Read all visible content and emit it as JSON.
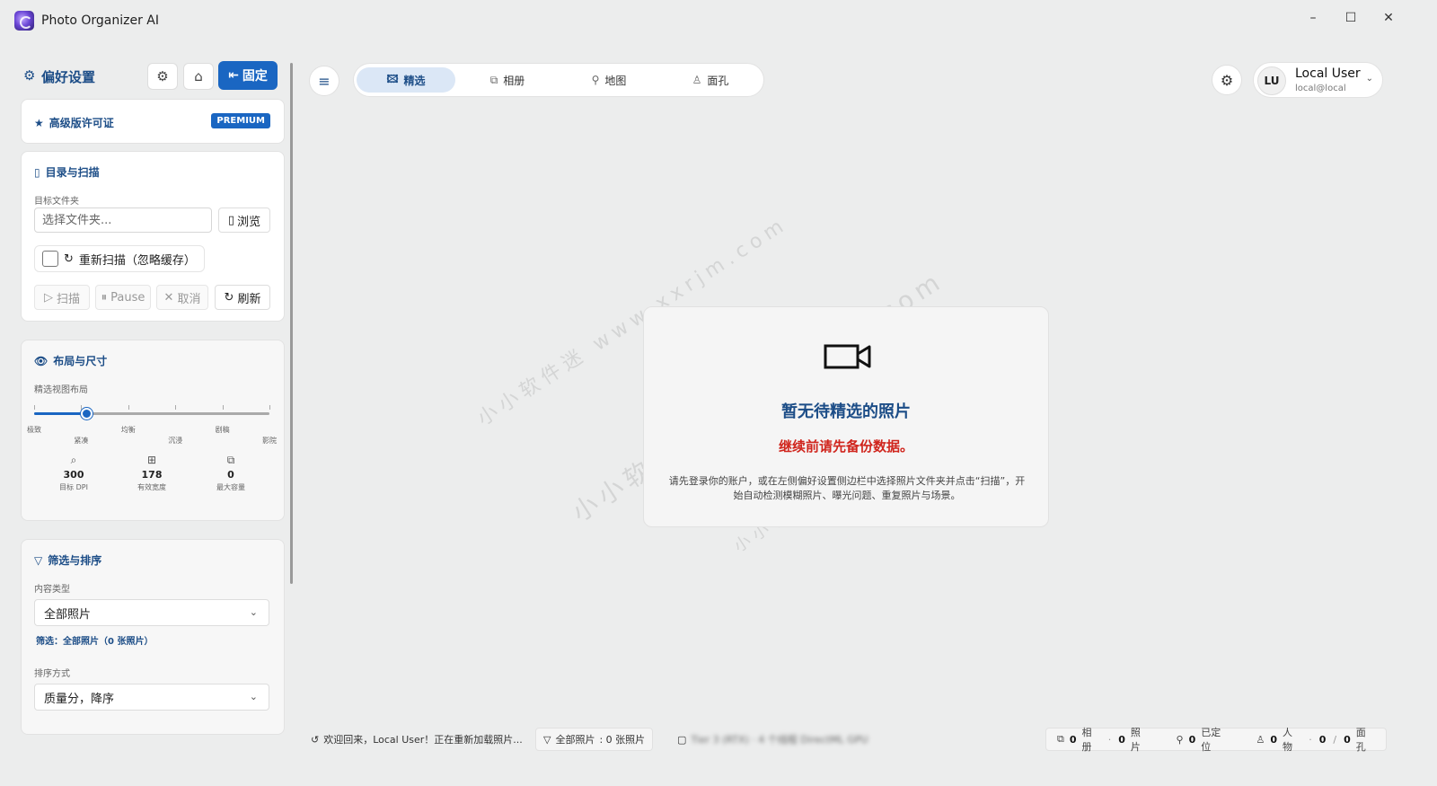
{
  "app": {
    "title": "Photo Organizer AI"
  },
  "window": {
    "minimize": "–",
    "maximize": "☐",
    "close": "✕"
  },
  "sidebar": {
    "header_title": "偏好设置",
    "pin_label": "固定",
    "premium": {
      "label": "高级版许可证",
      "badge": "PREMIUM"
    },
    "directory": {
      "title": "目录与扫描",
      "folder_label": "目标文件夹",
      "folder_placeholder": "选择文件夹...",
      "browse_label": "浏览",
      "rescan_label": "重新扫描（忽略缓存）",
      "scan_label": "扫描",
      "pause_label": "Pause",
      "cancel_label": "取消",
      "refresh_label": "刷新"
    },
    "layout": {
      "title": "布局与尺寸",
      "view_label": "精选视图布局",
      "slider_value_percent": 22,
      "ticks": [
        "极致",
        "紧凑",
        "均衡",
        "沉浸",
        "剧稿",
        "影院"
      ],
      "stats": [
        {
          "value": "300",
          "label": "目标 DPI",
          "icon": "dpi-icon"
        },
        {
          "value": "178",
          "label": "有效宽度",
          "icon": "grid-icon"
        },
        {
          "value": "0",
          "label": "最大容量",
          "icon": "stack-icon"
        }
      ]
    },
    "filter": {
      "title": "筛选与排序",
      "content_type_label": "内容类型",
      "content_type_value": "全部照片",
      "summary": "筛选：全部照片（0 张照片）",
      "sort_label": "排序方式",
      "sort_value": "质量分，降序"
    }
  },
  "nav": {
    "tabs": [
      {
        "label": "精选",
        "icon": "image-icon"
      },
      {
        "label": "相册",
        "icon": "album-icon"
      },
      {
        "label": "地图",
        "icon": "map-pin-icon"
      },
      {
        "label": "面孔",
        "icon": "person-icon"
      }
    ],
    "active_tab": 0
  },
  "user": {
    "initials": "LU",
    "name": "Local User",
    "email": "local@local"
  },
  "empty_state": {
    "title": "暂无待精选的照片",
    "warning": "继续前请先备份数据。",
    "description": "请先登录你的账户，或在左侧偏好设置侧边栏中选择照片文件夹并点击“扫描”，开始自动检测模糊照片、曝光问题、重复照片与场景。"
  },
  "watermark": {
    "text": "小小软件迷  www.xxrjm.com"
  },
  "status": {
    "message": "欢迎回来，Local User！正在重新加载照片...",
    "filter_label": "全部照片",
    "filter_count": ": 0 张照片",
    "gpu_text": "Tier 3 (RTX) · 4 个线程 DirectML GPU",
    "albums_count": "0",
    "albums_label": "相册",
    "photos_count": "0",
    "photos_label": "照片",
    "located_count": "0",
    "located_label": "已定位",
    "people_count": "0",
    "people_label": "人物",
    "faces_count": "0",
    "faces_label": "面孔",
    "slash": "/"
  }
}
